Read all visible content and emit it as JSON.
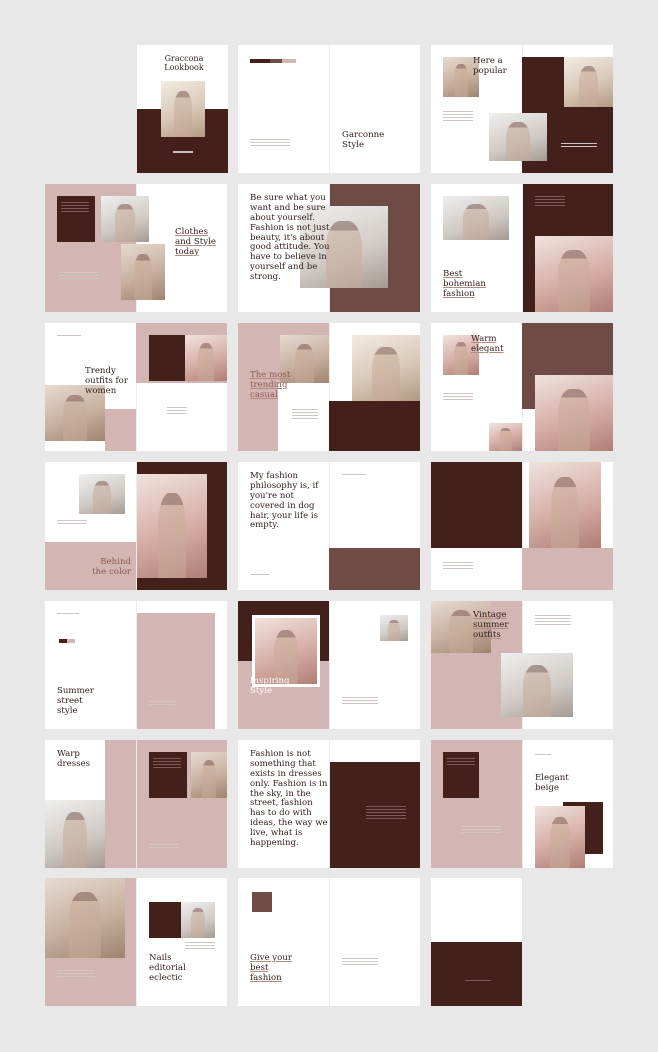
{
  "cover": {
    "title": "Graccona Lookbook"
  },
  "headlines": {
    "r1_b": "Garconne Style",
    "r1_c": "Here a popular",
    "r2_a": "Clothes and Style today",
    "r2_b": "Be sure what you want and be sure about yourself. Fashion is not just beauty, it's about good attitude. You have to believe in yourself and be strong.",
    "r2_c": "Best bohemian fashion",
    "r3_a": "Trendy outfits for women",
    "r3_b": "The most trending casual",
    "r3_c": "Warm elegant",
    "r4_a": "Behind the color",
    "r4_b": "My fashion philosophy is, if you're not covered in dog hair, your life is empty.",
    "r5_a": "Summer street style",
    "r5_b": "Inspiring Style",
    "r5_c": "Vintage summer outfits",
    "r6_a": "Warp dresses",
    "r6_b": "Fashion is not something that exists in dresses only. Fashion is in the sky, in the street, fashion has to do with ideas, the way we live, what is happening.",
    "r6_c": "Elegant beige",
    "r7_a": "Nails editorial eclectic",
    "r7_b": "Give your best fashion"
  },
  "colors": {
    "background": "#e8e8e8",
    "maroon": "#44201b",
    "brown": "#6e4b44",
    "pink": "#d3b5b3",
    "white": "#ffffff"
  },
  "icons": [
    "photo-placeholder",
    "page-arrow-icon"
  ]
}
